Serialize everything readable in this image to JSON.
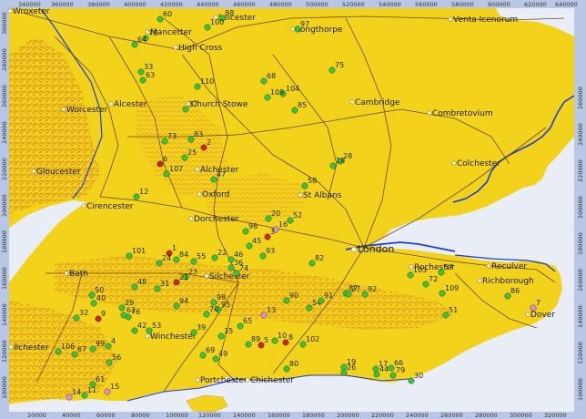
{
  "colors": {
    "land": "#f2d21a",
    "land_light": "#f7e44a",
    "relief": "#d9772a",
    "relief_dark": "#b4421e",
    "sea": "#e9eef6",
    "water": "#1d3fd6",
    "road": "#5c3a1e",
    "site": "#3cc43c",
    "site_red": "#d42020",
    "site_pink": "#e88ad8",
    "town_dot": "#fff6c0",
    "frame": "#b9c7e6"
  },
  "axes": {
    "top_ticks": [
      "340000",
      "360000",
      "380000",
      "400000",
      "420000",
      "440000",
      "460000",
      "480000",
      "500000",
      "520000",
      "540000",
      "560000",
      "580000",
      "600000",
      "620000",
      "640000"
    ],
    "bottom_ticks": [
      "20000",
      "40000",
      "60000",
      "80000",
      "100000",
      "120000",
      "140000",
      "160000",
      "180000",
      "200000",
      "220000",
      "240000",
      "260000",
      "280000",
      "300000",
      "320000"
    ],
    "left_ticks": [
      "300000",
      "280000",
      "260000",
      "240000",
      "220000",
      "200000",
      "180000",
      "160000",
      "140000",
      "120000",
      "100000"
    ],
    "right_ticks": [
      "260000",
      "240000",
      "220000",
      "200000",
      "180000",
      "160000",
      "140000",
      "120000",
      "100000"
    ]
  },
  "towns": [
    {
      "name": "Wroxeter"
    },
    {
      "name": "Leicester"
    },
    {
      "name": "Mancetter"
    },
    {
      "name": "High Cross"
    },
    {
      "name": "Longthorpe"
    },
    {
      "name": "Venta Icenorum"
    },
    {
      "name": "Alcester"
    },
    {
      "name": "Worcester"
    },
    {
      "name": "Church Stowe"
    },
    {
      "name": "Cambridge"
    },
    {
      "name": "Combretovium"
    },
    {
      "name": "Gloucester"
    },
    {
      "name": "Alchester"
    },
    {
      "name": "Colchester"
    },
    {
      "name": "Cirencester"
    },
    {
      "name": "Oxford"
    },
    {
      "name": "St Albans"
    },
    {
      "name": "Dorchester"
    },
    {
      "name": "London",
      "big": true
    },
    {
      "name": "Reculver"
    },
    {
      "name": "Bath"
    },
    {
      "name": "Silchester"
    },
    {
      "name": "Rochester"
    },
    {
      "name": "Richborough"
    },
    {
      "name": "Dover"
    },
    {
      "name": "Ilchester"
    },
    {
      "name": "Winchester"
    },
    {
      "name": "Portchester"
    },
    {
      "name": "Chichester"
    }
  ],
  "sites": [
    {
      "label": "60",
      "c": "green"
    },
    {
      "label": "88",
      "c": "green"
    },
    {
      "label": "100",
      "c": "green"
    },
    {
      "label": "78",
      "c": "green"
    },
    {
      "label": "64",
      "c": "green"
    },
    {
      "label": "97",
      "c": "green"
    },
    {
      "label": "75",
      "c": "green"
    },
    {
      "label": "33",
      "c": "green"
    },
    {
      "label": "63",
      "c": "green"
    },
    {
      "label": "68",
      "c": "green"
    },
    {
      "label": "110",
      "c": "green"
    },
    {
      "label": "104",
      "c": "green"
    },
    {
      "label": "108",
      "c": "green"
    },
    {
      "label": "37",
      "c": "green"
    },
    {
      "label": "85",
      "c": "green"
    },
    {
      "label": "73",
      "c": "green"
    },
    {
      "label": "83",
      "c": "green"
    },
    {
      "label": "2",
      "c": "red"
    },
    {
      "label": "25",
      "c": "green"
    },
    {
      "label": "6",
      "c": "red"
    },
    {
      "label": "107",
      "c": "green"
    },
    {
      "label": "28",
      "c": "green"
    },
    {
      "label": "18",
      "c": "green"
    },
    {
      "label": "47",
      "c": "green"
    },
    {
      "label": "58",
      "c": "green"
    },
    {
      "label": "12",
      "c": "green"
    },
    {
      "label": "20",
      "c": "green"
    },
    {
      "label": "52",
      "c": "green"
    },
    {
      "label": "96",
      "c": "green"
    },
    {
      "label": "16",
      "c": "pink"
    },
    {
      "label": "3",
      "c": "red"
    },
    {
      "label": "45",
      "c": "green"
    },
    {
      "label": "93",
      "c": "green"
    },
    {
      "label": "101",
      "c": "green"
    },
    {
      "label": "1",
      "c": "red"
    },
    {
      "label": "84",
      "c": "green"
    },
    {
      "label": "24",
      "c": "green"
    },
    {
      "label": "22",
      "c": "green"
    },
    {
      "label": "46",
      "c": "green"
    },
    {
      "label": "55",
      "c": "green"
    },
    {
      "label": "36",
      "c": "green"
    },
    {
      "label": "82",
      "c": "green"
    },
    {
      "label": "23",
      "c": "green"
    },
    {
      "label": "21",
      "c": "red"
    },
    {
      "label": "48",
      "c": "green"
    },
    {
      "label": "31",
      "c": "green"
    },
    {
      "label": "74",
      "c": "green"
    },
    {
      "label": "103",
      "c": "green"
    },
    {
      "label": "57",
      "c": "green"
    },
    {
      "label": "72",
      "c": "green"
    },
    {
      "label": "109",
      "c": "green"
    },
    {
      "label": "86",
      "c": "green"
    },
    {
      "label": "50",
      "c": "green"
    },
    {
      "label": "40",
      "c": "green"
    },
    {
      "label": "94",
      "c": "green"
    },
    {
      "label": "98",
      "c": "green"
    },
    {
      "label": "95",
      "c": "green"
    },
    {
      "label": "90",
      "c": "green"
    },
    {
      "label": "54",
      "c": "green"
    },
    {
      "label": "91",
      "c": "green"
    },
    {
      "label": "87",
      "c": "green"
    },
    {
      "label": "27",
      "c": "green"
    },
    {
      "label": "92",
      "c": "green"
    },
    {
      "label": "7",
      "c": "pink"
    },
    {
      "label": "32",
      "c": "green"
    },
    {
      "label": "29",
      "c": "green"
    },
    {
      "label": "76",
      "c": "green"
    },
    {
      "label": "9",
      "c": "red"
    },
    {
      "label": "62",
      "c": "green"
    },
    {
      "label": "70",
      "c": "green"
    },
    {
      "label": "13",
      "c": "pink"
    },
    {
      "label": "51",
      "c": "green"
    },
    {
      "label": "42",
      "c": "green"
    },
    {
      "label": "53",
      "c": "green"
    },
    {
      "label": "39",
      "c": "green"
    },
    {
      "label": "35",
      "c": "green"
    },
    {
      "label": "65",
      "c": "green"
    },
    {
      "label": "10",
      "c": "green"
    },
    {
      "label": "8",
      "c": "red"
    },
    {
      "label": "89",
      "c": "green"
    },
    {
      "label": "5",
      "c": "red"
    },
    {
      "label": "102",
      "c": "green"
    },
    {
      "label": "106",
      "c": "green"
    },
    {
      "label": "67",
      "c": "green"
    },
    {
      "label": "99",
      "c": "green"
    },
    {
      "label": "4",
      "c": "green"
    },
    {
      "label": "69",
      "c": "green"
    },
    {
      "label": "49",
      "c": "green"
    },
    {
      "label": "56",
      "c": "green"
    },
    {
      "label": "19",
      "c": "green"
    },
    {
      "label": "80",
      "c": "green"
    },
    {
      "label": "26",
      "c": "green"
    },
    {
      "label": "17",
      "c": "green"
    },
    {
      "label": "44",
      "c": "green"
    },
    {
      "label": "66",
      "c": "green"
    },
    {
      "label": "79",
      "c": "green"
    },
    {
      "label": "30",
      "c": "green"
    },
    {
      "label": "61",
      "c": "green"
    },
    {
      "label": "14",
      "c": "pink"
    },
    {
      "label": "11",
      "c": "green"
    },
    {
      "label": "15",
      "c": "pink"
    }
  ]
}
